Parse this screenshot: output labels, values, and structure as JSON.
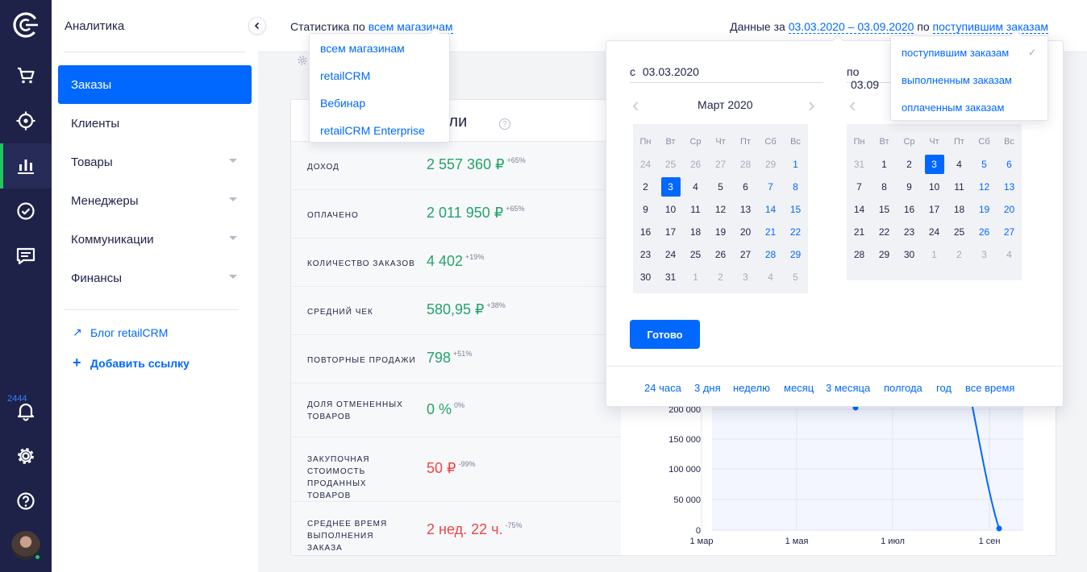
{
  "rail": {
    "badge": "2444"
  },
  "sidebar": {
    "title": "Аналитика",
    "items": [
      {
        "label": "Заказы",
        "active": true,
        "caret": false
      },
      {
        "label": "Клиенты",
        "active": false,
        "caret": false
      },
      {
        "label": "Товары",
        "active": false,
        "caret": true
      },
      {
        "label": "Менеджеры",
        "active": false,
        "caret": true
      },
      {
        "label": "Коммуникации",
        "active": false,
        "caret": true
      },
      {
        "label": "Финансы",
        "active": false,
        "caret": true
      }
    ],
    "blog_link": "Блог retailCRM",
    "add_link": "Добавить ссылку"
  },
  "header": {
    "stats_prefix": "Статистика по",
    "stats_value": "всем магазинам",
    "data_prefix": "Данные за",
    "date_range": "03.03.2020 – 03.09.2020",
    "by_word": "по",
    "order_type": "поступившим заказам"
  },
  "store_dropdown": {
    "options": [
      "всем магазинам",
      "retailCRM",
      "Вебинар",
      "retailCRM Enterprise"
    ]
  },
  "card": {
    "title": "тели",
    "metrics": [
      {
        "label": "Доход",
        "value": "2 557 360 ₽",
        "delta": "+65%",
        "color": "#22a36a"
      },
      {
        "label": "Оплачено",
        "value": "2 011 950 ₽",
        "delta": "+65%",
        "color": "#22a36a"
      },
      {
        "label": "Количество заказов",
        "value": "4 402",
        "delta": "+19%",
        "color": "#22a36a"
      },
      {
        "label": "Средний чек",
        "value": "580,95 ₽",
        "delta": "+38%",
        "color": "#22a36a"
      },
      {
        "label": "Повторные продажи",
        "value": "798",
        "delta": "+51%",
        "color": "#22a36a"
      },
      {
        "label": "Доля отмененных товаров",
        "value": "0 %",
        "delta": "0%",
        "color": "#22a36a"
      },
      {
        "label": "Закупочная стоимость проданных товаров",
        "value": "50 ₽",
        "delta": "-99%",
        "color": "#f04444"
      },
      {
        "label": "Среднее время выполнения заказа",
        "value": "2 нед. 22 ч.",
        "delta": "-75%",
        "color": "#f04444"
      }
    ]
  },
  "chart": {
    "y_ticks": [
      "200 000",
      "150 000",
      "100 000",
      "50 000",
      "0"
    ],
    "x_ticks": [
      "1 мар",
      "1 мая",
      "1 июл",
      "1 сен"
    ]
  },
  "date_picker": {
    "from_prefix": "с",
    "from_value": "03.03.2020",
    "to_prefix": "по",
    "to_value": "03.09",
    "left_month": "Март 2020",
    "weekdays": [
      "Пн",
      "Вт",
      "Ср",
      "Чт",
      "Пт",
      "Сб",
      "Вс"
    ],
    "left_weeks": [
      [
        "24",
        "25",
        "26",
        "27",
        "28",
        "29",
        "1"
      ],
      [
        "2",
        "3",
        "4",
        "5",
        "6",
        "7",
        "8"
      ],
      [
        "9",
        "10",
        "11",
        "12",
        "13",
        "14",
        "15"
      ],
      [
        "16",
        "17",
        "18",
        "19",
        "20",
        "21",
        "22"
      ],
      [
        "23",
        "24",
        "25",
        "26",
        "27",
        "28",
        "29"
      ],
      [
        "30",
        "31",
        "1",
        "2",
        "3",
        "4",
        "5"
      ]
    ],
    "right_weeks": [
      [
        "31",
        "1",
        "2",
        "3",
        "4",
        "5",
        "6"
      ],
      [
        "7",
        "8",
        "9",
        "10",
        "11",
        "12",
        "13"
      ],
      [
        "14",
        "15",
        "16",
        "17",
        "18",
        "19",
        "20"
      ],
      [
        "21",
        "22",
        "23",
        "24",
        "25",
        "26",
        "27"
      ],
      [
        "28",
        "29",
        "30",
        "1",
        "2",
        "3",
        "4"
      ]
    ],
    "done_label": "Готово",
    "presets": [
      "24 часа",
      "3 дня",
      "неделю",
      "месяц",
      "3 месяца",
      "полгода",
      "год",
      "все время"
    ]
  },
  "order_type_dropdown": {
    "options": [
      "поступившим заказам",
      "выполненным заказам",
      "оплаченным заказам"
    ],
    "check": "✓"
  }
}
